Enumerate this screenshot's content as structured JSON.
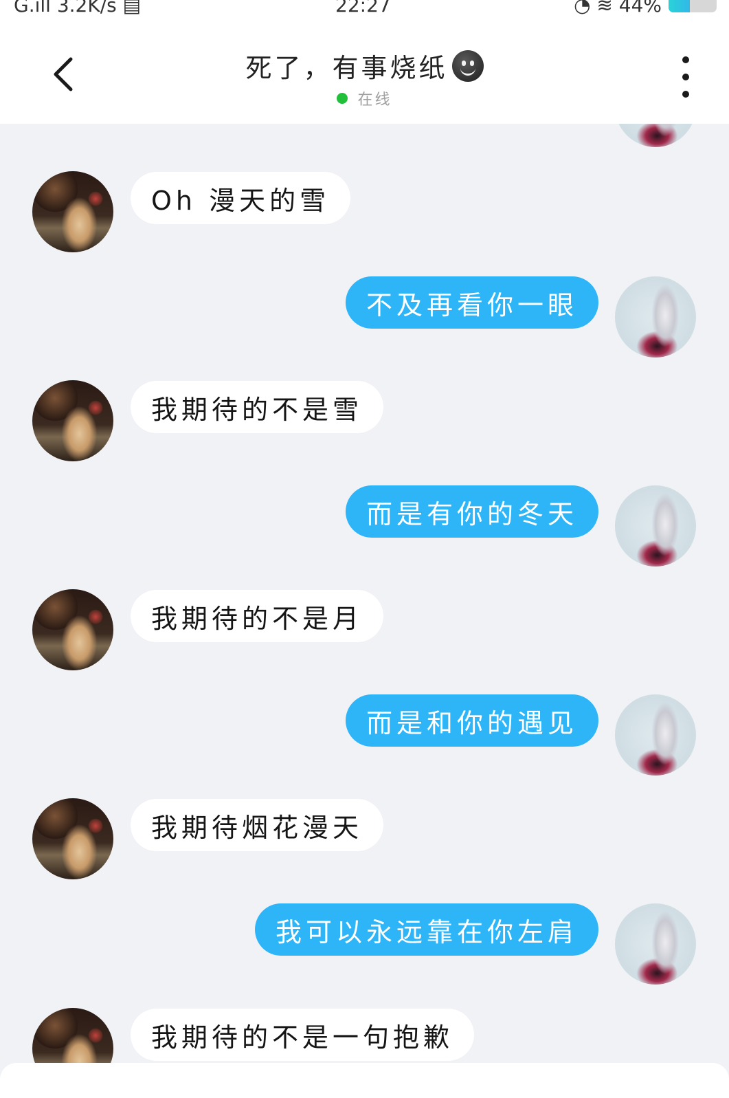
{
  "status_bar": {
    "left": "G.ıll 3.2K/s ▤",
    "time": "22:27",
    "right": "◔ ≋ 44%",
    "battery_level": 0.44
  },
  "header": {
    "title": "死了，有事烧纸",
    "status": "在线",
    "online_color": "#22c03a"
  },
  "colors": {
    "sent_bubble": "#2eb5f7",
    "received_bubble": "#ffffff",
    "background": "#f1f2f6"
  },
  "messages": [
    {
      "side": "left",
      "text": "Oh  漫天的雪"
    },
    {
      "side": "right",
      "text": "不及再看你一眼"
    },
    {
      "side": "left",
      "text": "我期待的不是雪"
    },
    {
      "side": "right",
      "text": "而是有你的冬天"
    },
    {
      "side": "left",
      "text": "我期待的不是月"
    },
    {
      "side": "right",
      "text": "而是和你的遇见"
    },
    {
      "side": "left",
      "text": "我期待烟花漫天"
    },
    {
      "side": "right",
      "text": "我可以永远靠在你左肩"
    },
    {
      "side": "left",
      "text": "我期待的不是一句抱歉"
    }
  ]
}
